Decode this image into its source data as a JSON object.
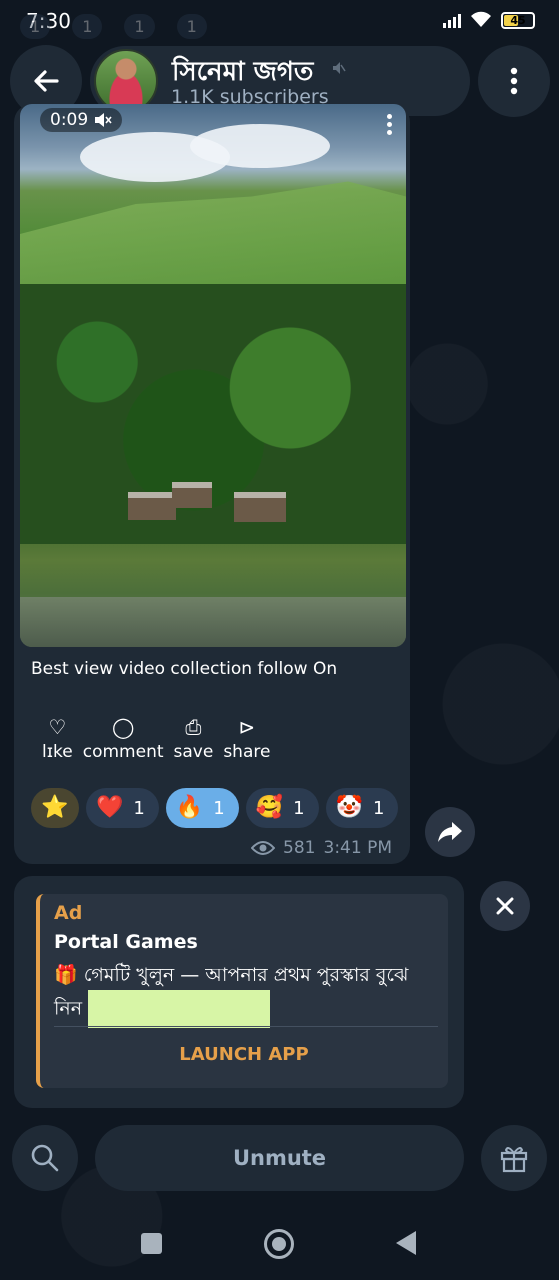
{
  "status_bar": {
    "time": "7:30",
    "battery": "45"
  },
  "ghost_reactions": [
    "1",
    "1",
    "1",
    "1"
  ],
  "header": {
    "channel_title": "সিনেমা জগত",
    "subscribers": "1.1K subscribers"
  },
  "post": {
    "video_time": "0:09",
    "caption": "Best view video collection follow On",
    "actions": [
      {
        "icon": "heart-outline-icon",
        "glyph": "♡",
        "label": "lɪke"
      },
      {
        "icon": "speech-bubble-icon",
        "glyph": "◯",
        "label": "comment"
      },
      {
        "icon": "save-icon",
        "glyph": "⎙",
        "label": "save"
      },
      {
        "icon": "send-icon",
        "glyph": "⊳",
        "label": "share"
      }
    ],
    "reactions": [
      {
        "emoji": "⭐",
        "count": "",
        "active": false
      },
      {
        "emoji": "❤️",
        "count": "1",
        "active": false
      },
      {
        "emoji": "🔥",
        "count": "1",
        "active": true
      },
      {
        "emoji": "🥰",
        "count": "1",
        "active": false
      },
      {
        "emoji": "🤡",
        "count": "1",
        "active": false
      }
    ],
    "views": "581",
    "time": "3:41 PM"
  },
  "ad": {
    "label": "Ad",
    "title": "Portal Games",
    "gift_emoji": "🎁",
    "text": "গেমটি খুলুন — আপনার প্রথম পুরস্কার বুঝে নিন",
    "launch_label": "LAUNCH APP"
  },
  "bottom_bar": {
    "unmute_label": "Unmute"
  },
  "colors": {
    "background": "#0f1721",
    "bubble": "#1f2a36",
    "accent_ad": "#e6a04a",
    "active_reaction": "#6aaee8"
  }
}
